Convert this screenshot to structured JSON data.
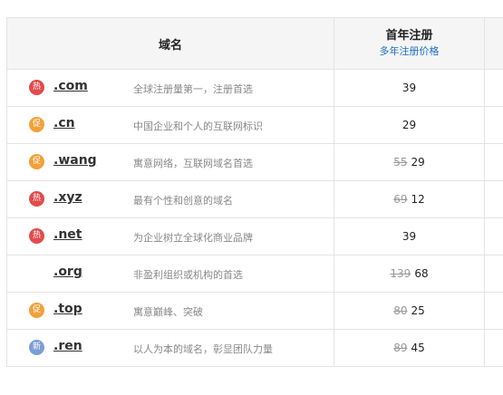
{
  "header": {
    "domain_col": "域名",
    "price_col": "首年注册",
    "price_link": "多年注册价格"
  },
  "rows": [
    {
      "badge": "热",
      "badge_type": "hot",
      "tld": ".com",
      "desc": "全球注册量第一，注册首选",
      "old_price": "",
      "price": "39"
    },
    {
      "badge": "促",
      "badge_type": "promo",
      "tld": ".cn",
      "desc": "中国企业和个人的互联网标识",
      "old_price": "",
      "price": "29"
    },
    {
      "badge": "促",
      "badge_type": "promo",
      "tld": ".wang",
      "desc": "寓意网络，互联网域名首选",
      "old_price": "55",
      "price": "29"
    },
    {
      "badge": "热",
      "badge_type": "hot",
      "tld": ".xyz",
      "desc": "最有个性和创意的域名",
      "old_price": "69",
      "price": "12"
    },
    {
      "badge": "热",
      "badge_type": "hot",
      "tld": ".net",
      "desc": "为企业树立全球化商业品牌",
      "old_price": "",
      "price": "39"
    },
    {
      "badge": "",
      "badge_type": "",
      "tld": ".org",
      "desc": "非盈利组织或机构的首选",
      "old_price": "139",
      "price": "68"
    },
    {
      "badge": "促",
      "badge_type": "promo",
      "tld": ".top",
      "desc": "寓意巅峰、突破",
      "old_price": "80",
      "price": "25"
    },
    {
      "badge": "新",
      "badge_type": "new",
      "tld": ".ren",
      "desc": "以人为本的域名，彰显团队力量",
      "old_price": "89",
      "price": "45"
    }
  ],
  "colors": {
    "hot": "#e24b4b",
    "promo": "#f3a03a",
    "new": "#7b9ed4",
    "link": "#1e6fbf"
  }
}
